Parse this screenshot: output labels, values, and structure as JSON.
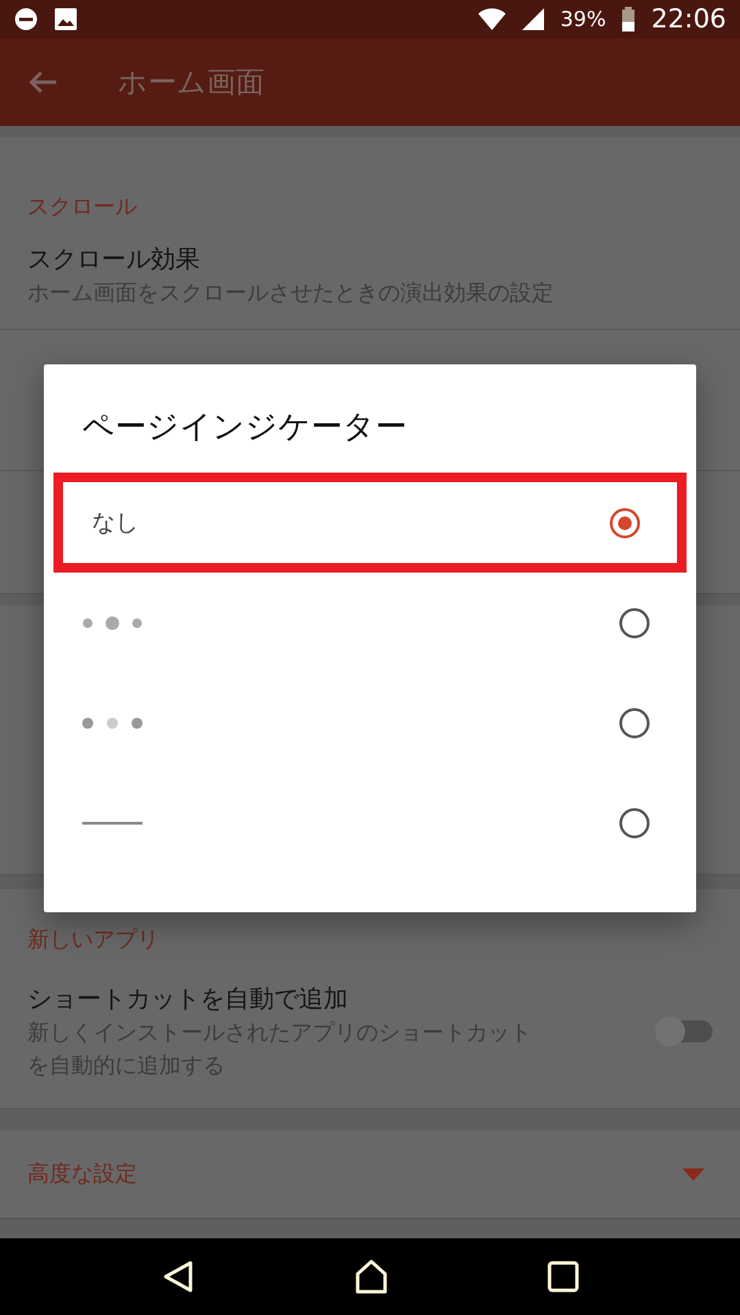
{
  "status_bar": {
    "battery": "39%",
    "time": "22:06"
  },
  "app_bar": {
    "title": "ホーム画面"
  },
  "sections": [
    {
      "header": "スクロール",
      "rows": [
        {
          "kind": "text",
          "title": "スクロール効果",
          "description": [
            "ホーム画面をスクロールさせたときの演出効果の設定"
          ]
        }
      ]
    },
    {
      "header": "新しいアプリ",
      "rows": [
        {
          "kind": "switch",
          "title": "ショートカットを自動で追加",
          "description": [
            "新しくインストールされたアプリのショートカット",
            "を自動的に追加する"
          ],
          "on": false
        }
      ]
    }
  ],
  "advanced": {
    "label": "高度な設定",
    "expanded": false
  },
  "dialog": {
    "title": "ページインジケーター",
    "options": [
      {
        "kind": "text",
        "label": "なし",
        "selected": true,
        "highlighted": true
      },
      {
        "kind": "dots-big-middle",
        "selected": false,
        "highlighted": false
      },
      {
        "kind": "dots-light-middle",
        "selected": false,
        "highlighted": false
      },
      {
        "kind": "line",
        "selected": false,
        "highlighted": false
      }
    ]
  }
}
